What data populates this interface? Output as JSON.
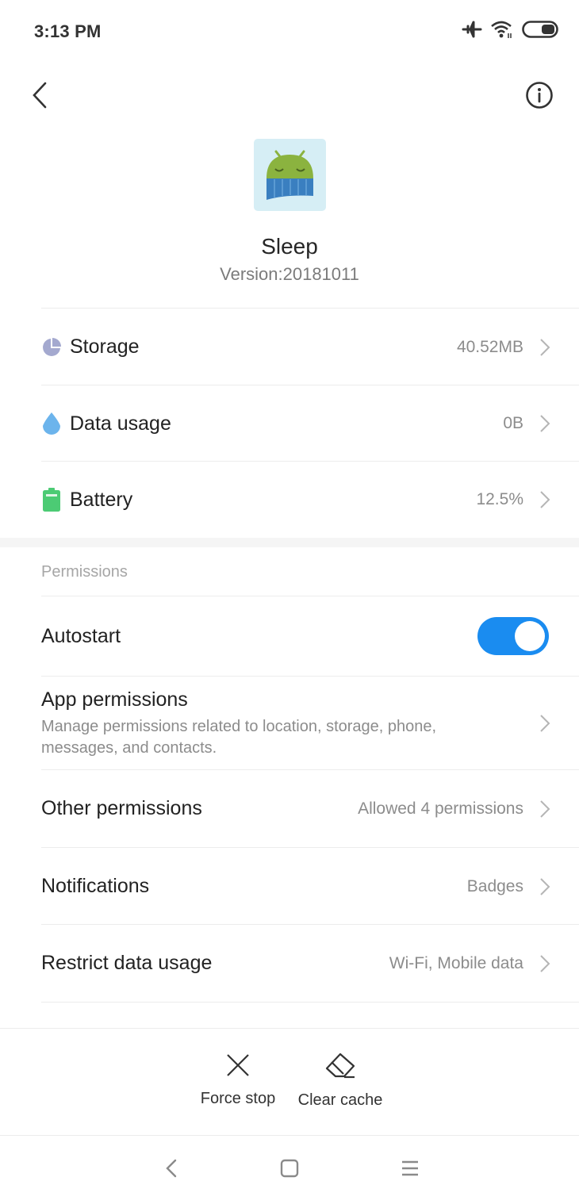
{
  "status_bar": {
    "time": "3:13 PM",
    "icons": [
      "airplane-mode-icon",
      "wifi-icon",
      "battery-icon"
    ]
  },
  "top_bar": {
    "back_icon": "chevron-left-icon",
    "info_icon": "info-icon"
  },
  "app": {
    "name": "Sleep",
    "version": "Version:20181011",
    "colors": {
      "icon_bg": "#d6eef5",
      "android_green": "#8bb33f",
      "blanket_blue": "#3a7fc0"
    }
  },
  "usage_rows": [
    {
      "icon": "pie-chart-icon",
      "label": "Storage",
      "value": "40.52MB",
      "icon_color": "#a4a9cf"
    },
    {
      "icon": "water-drop-icon",
      "label": "Data usage",
      "value": "0B",
      "icon_color": "#6cb4ec"
    },
    {
      "icon": "battery-icon",
      "label": "Battery",
      "value": "12.5%",
      "icon_color": "#4ccb74"
    }
  ],
  "permissions": {
    "section_title": "Permissions",
    "autostart": {
      "label": "Autostart",
      "enabled": true,
      "accent": "#1a8cf0"
    },
    "app_permissions": {
      "label": "App permissions",
      "description": "Manage permissions related to location, storage, phone, messages, and contacts."
    },
    "rows": [
      {
        "label": "Other permissions",
        "value": "Allowed 4 permissions"
      },
      {
        "label": "Notifications",
        "value": "Badges"
      },
      {
        "label": "Restrict data usage",
        "value": "Wi-Fi, Mobile data"
      }
    ]
  },
  "actions": {
    "force_stop": "Force stop",
    "clear_cache": "Clear cache"
  },
  "nav_bar": {
    "back": "nav-back-icon",
    "home": "nav-home-icon",
    "menu": "nav-recents-icon"
  }
}
